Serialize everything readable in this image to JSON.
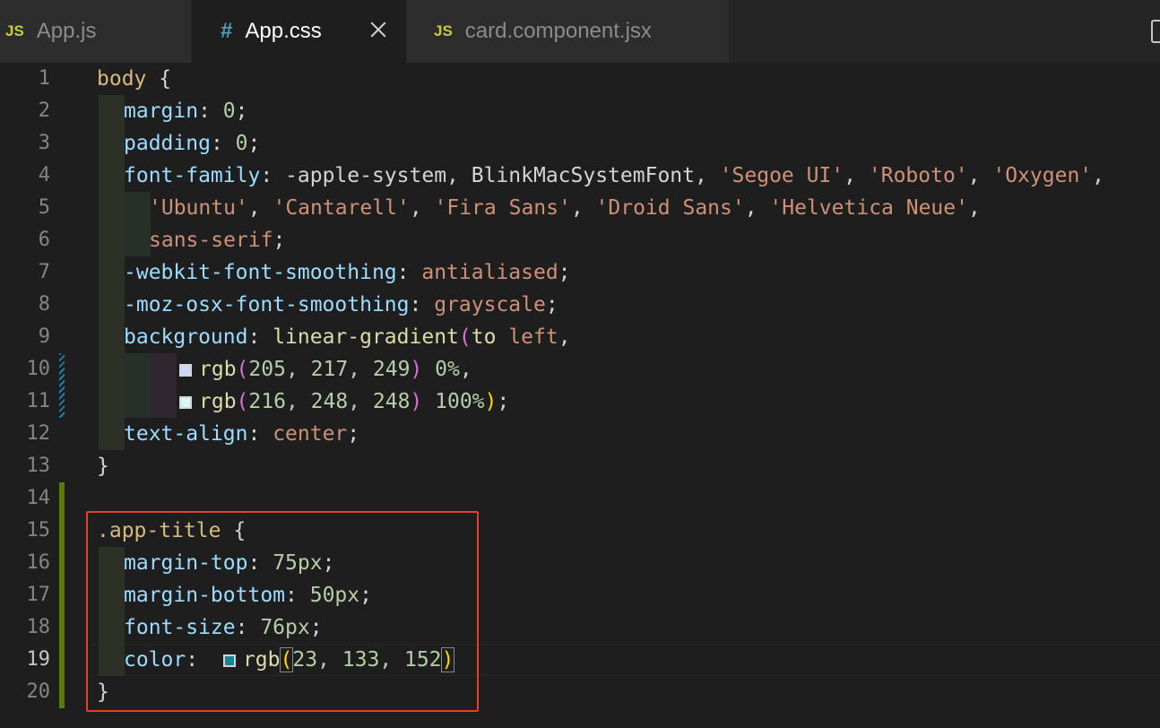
{
  "tabs": [
    {
      "icon": "JS",
      "label": "App.js"
    },
    {
      "icon": "#",
      "label": "App.css"
    },
    {
      "icon": "JS",
      "label": "card.component.jsx"
    }
  ],
  "line_numbers": [
    "1",
    "2",
    "3",
    "4",
    "5",
    "6",
    "7",
    "8",
    "9",
    "10",
    "11",
    "12",
    "13",
    "14",
    "15",
    "16",
    "17",
    "18",
    "19",
    "20"
  ],
  "code": {
    "l1": {
      "selector": "body",
      "brace": " {"
    },
    "l2": {
      "prop": "margin",
      "colon": ": ",
      "value": "0",
      "semi": ";"
    },
    "l3": {
      "prop": "padding",
      "colon": ": ",
      "value": "0",
      "semi": ";"
    },
    "l4": {
      "prop": "font-family",
      "colon": ": ",
      "v1": "-apple-system, BlinkMacSystemFont, ",
      "s1": "'Segoe UI'",
      "c1": ", ",
      "s2": "'Roboto'",
      "c2": ", ",
      "s3": "'Oxygen'",
      "c3": ","
    },
    "l5": {
      "s1": "'Ubuntu'",
      "c1": ", ",
      "s2": "'Cantarell'",
      "c2": ", ",
      "s3": "'Fira Sans'",
      "c3": ", ",
      "s4": "'Droid Sans'",
      "c4": ", ",
      "s5": "'Helvetica Neue'",
      "c5": ","
    },
    "l6": {
      "value": "sans-serif",
      "semi": ";"
    },
    "l7": {
      "prop": "-webkit-font-smoothing",
      "colon": ": ",
      "value": "antialiased",
      "semi": ";"
    },
    "l8": {
      "prop": "-moz-osx-font-smoothing",
      "colon": ": ",
      "value": "grayscale",
      "semi": ";"
    },
    "l9": {
      "prop": "background",
      "colon": ": ",
      "fn": "linear-gradient",
      "open": "(",
      "kw": "to ",
      "dir": "left",
      "comma": ","
    },
    "l10": {
      "fn": "rgb",
      "open": "(",
      "args": "205, 217, 249",
      "close": ")",
      "pct": " 0%",
      "comma": ",",
      "swatch": "#cdd9f9"
    },
    "l11": {
      "fn": "rgb",
      "open": "(",
      "args": "216, 248, 248",
      "close": ")",
      "pct": " 100%",
      "close2": ")",
      "semi": ";",
      "swatch": "#d8f8f8"
    },
    "l12": {
      "prop": "text-align",
      "colon": ": ",
      "value": "center",
      "semi": ";"
    },
    "l13": {
      "brace": "}"
    },
    "l15": {
      "selector": ".app-title",
      "brace": " {"
    },
    "l16": {
      "prop": "margin-top",
      "colon": ": ",
      "value": "75px",
      "semi": ";"
    },
    "l17": {
      "prop": "margin-bottom",
      "colon": ": ",
      "value": "50px",
      "semi": ";"
    },
    "l18": {
      "prop": "font-size",
      "colon": ": ",
      "value": "76px",
      "semi": ";"
    },
    "l19": {
      "prop": "color",
      "colon": ": ",
      "fn": "rgb",
      "open": "(",
      "args": "23, 133, 152",
      "close": ")",
      "swatch": "#178598"
    },
    "l20": {
      "brace": "}"
    }
  },
  "colors": {
    "highlight_box": "#e0412b",
    "added_gutter": "#587c0c",
    "modified_gutter": "#1b81a8"
  },
  "icons": [
    "js-file-icon",
    "css-file-icon",
    "close-icon",
    "split-editor-icon"
  ]
}
